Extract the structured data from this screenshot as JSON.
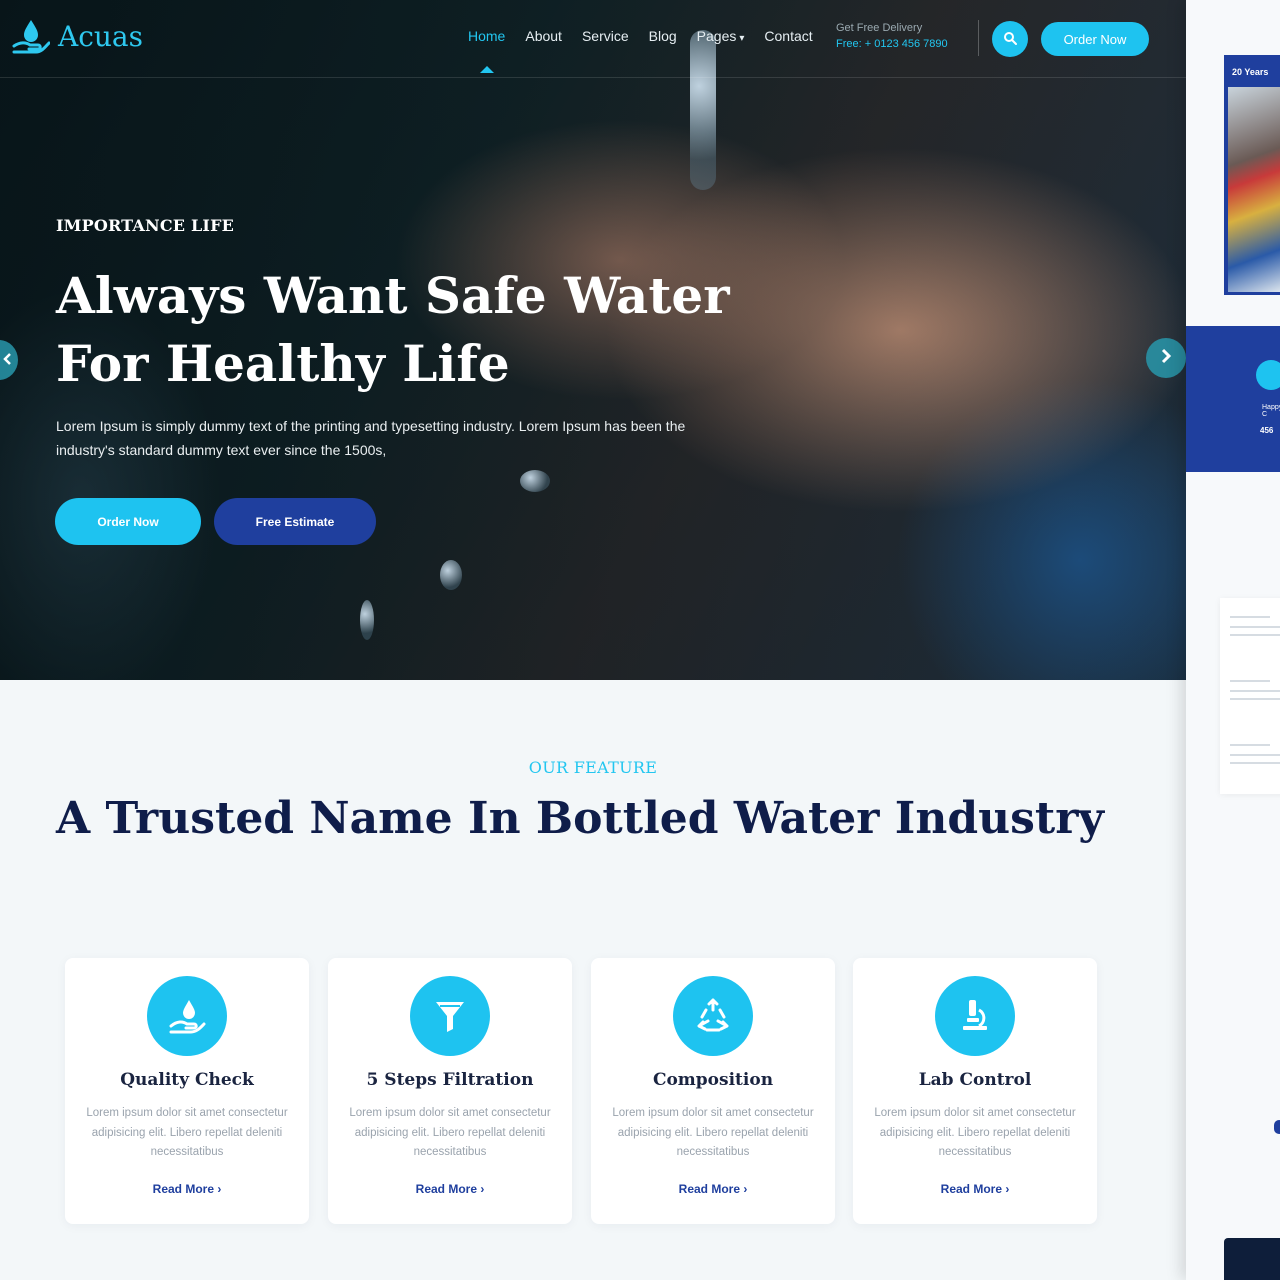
{
  "brand": {
    "name": "Acuas"
  },
  "nav": {
    "items": [
      {
        "label": "Home",
        "active": true
      },
      {
        "label": "About"
      },
      {
        "label": "Service"
      },
      {
        "label": "Blog"
      },
      {
        "label": "Pages"
      },
      {
        "label": "Contact"
      }
    ],
    "delivery_label": "Get Free Delivery",
    "delivery_phone": "Free: + 0123 456 7890",
    "order_button": "Order Now"
  },
  "hero": {
    "subtitle": "IMPORTANCE LIFE",
    "title": "Always Want Safe Water For Healthy Life",
    "description": "Lorem Ipsum is simply dummy text of the printing and typesetting industry. Lorem Ipsum has been the industry's standard dummy text ever since the 1500s,",
    "primary_button": "Order Now",
    "secondary_button": "Free Estimate"
  },
  "features": {
    "label": "OUR FEATURE",
    "title": "A Trusted Name In Bottled Water Industry",
    "cards": [
      {
        "icon": "water-drop-hand-icon",
        "title": "Quality Check",
        "text": "Lorem ipsum dolor sit amet consectetur adipisicing elit. Libero repellat deleniti necessitatibus",
        "link": "Read More ›"
      },
      {
        "icon": "filter-funnel-icon",
        "title": "5 Steps Filtration",
        "text": "Lorem ipsum dolor sit amet consectetur adipisicing elit. Libero repellat deleniti necessitatibus",
        "link": "Read More ›"
      },
      {
        "icon": "recycle-icon",
        "title": "Composition",
        "text": "Lorem ipsum dolor sit amet consectetur adipisicing elit. Libero repellat deleniti necessitatibus",
        "link": "Read More ›"
      },
      {
        "icon": "microscope-icon",
        "title": "Lab Control",
        "text": "Lorem ipsum dolor sit amet consectetur adipisicing elit. Libero repellat deleniti necessitatibus",
        "link": "Read More ›"
      }
    ]
  },
  "preview_strip": {
    "badge": "20 Years",
    "stat_label": "Happy C",
    "stat_value": "456"
  },
  "colors": {
    "accent": "#1ec3f0",
    "primary": "#1f3f9e",
    "heading": "#0f1d4a"
  }
}
